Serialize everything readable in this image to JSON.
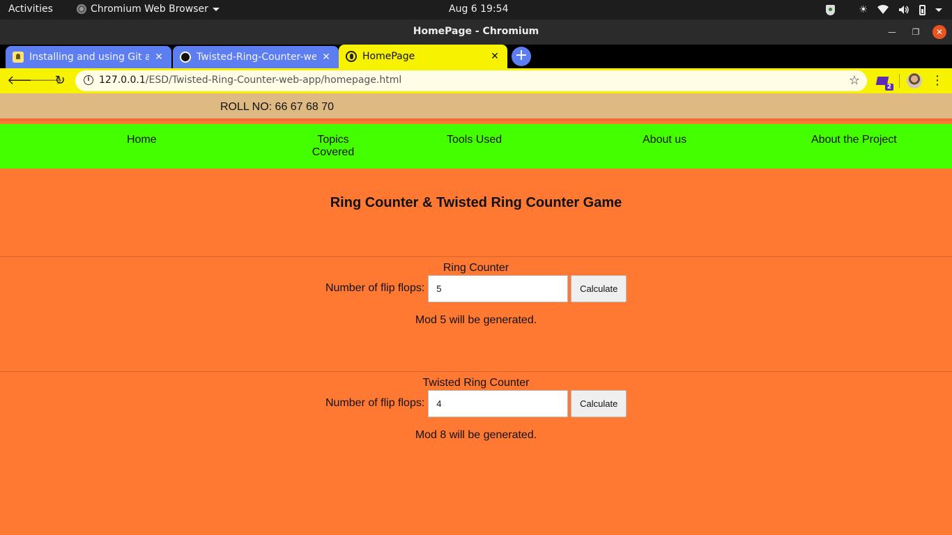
{
  "system_bar": {
    "activities": "Activities",
    "app_name": "Chromium Web Browser",
    "clock": "Aug 6  19:54"
  },
  "window": {
    "title": "HomePage - Chromium"
  },
  "tabs": [
    {
      "label": "Installing and using Git and",
      "icon": "lightbulb-icon"
    },
    {
      "label": "Twisted-Ring-Counter-web",
      "icon": "github-icon"
    },
    {
      "label": "HomePage",
      "icon": "globe-icon"
    }
  ],
  "address_bar": {
    "host": "127.0.0.1",
    "path": "/ESD/Twisted-Ring-Counter-web-app/homepage.html"
  },
  "extension_badge": "2",
  "page": {
    "roll_no": "ROLL NO: 66 67 68 70",
    "nav": {
      "home": "Home",
      "topics_line1": "Topics",
      "topics_line2": "Covered",
      "tools": "Tools Used",
      "about": "About us",
      "project": "About the Project"
    },
    "heading": "Ring Counter & Twisted Ring Counter Game",
    "ring": {
      "title": "Ring Counter",
      "label": "Number of flip flops:",
      "value": "5",
      "button": "Calculate",
      "result": "Mod 5 will be generated."
    },
    "twisted": {
      "title": "Twisted Ring Counter",
      "label": "Number of flip flops:",
      "value": "4",
      "button": "Calculate",
      "result": "Mod 8 will be generated."
    }
  },
  "colors": {
    "page_bg": "#ff7933",
    "roll_bar": "#deba82",
    "nav_bar": "#43ff00",
    "active_tab": "#f7f200",
    "inactive_tab": "#5d7ef0"
  }
}
